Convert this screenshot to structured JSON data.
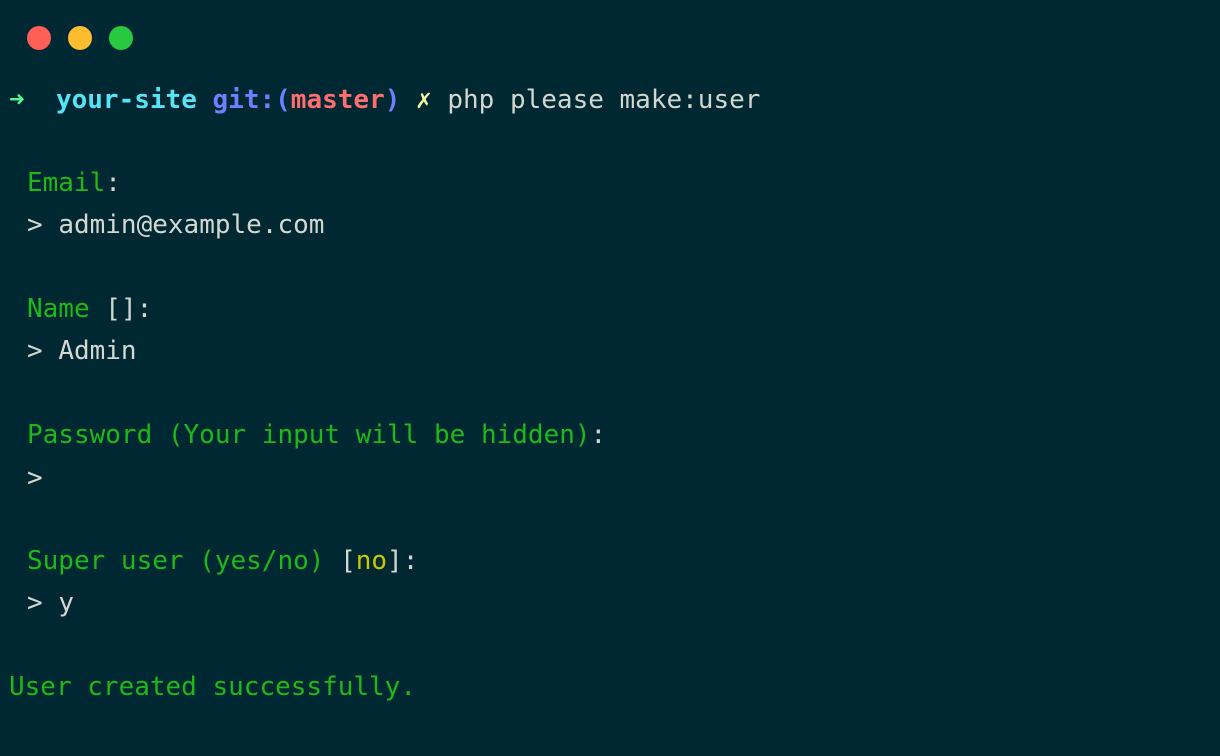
{
  "colors": {
    "background": "#002833",
    "close": "#ff5f57",
    "minimize": "#febc2e",
    "zoom": "#28c840",
    "arrow": "#5af78e",
    "dir": "#57e3f5",
    "git": "#6e7fff",
    "branch": "#ff6e6e",
    "dirty": "#f3f99d",
    "text": "#d3d7cf",
    "label": "#1fb818",
    "default_value": "#c8c800",
    "success": "#1fb818"
  },
  "window": {
    "close_icon": "close-icon",
    "minimize_icon": "minimize-icon",
    "zoom_icon": "zoom-icon"
  },
  "prompt": {
    "arrow": "➜",
    "directory": "your-site",
    "git_prefix": "git:(",
    "branch": "master",
    "git_suffix": ")",
    "dirty_mark": "✗",
    "command": "php please make:user"
  },
  "questions": {
    "email": {
      "label": "Email",
      "colon": ":",
      "answer_prefix": "> ",
      "answer": "admin@example.com"
    },
    "name": {
      "label": "Name",
      "default_open": " [",
      "default_value": "",
      "default_close": "]",
      "colon": ":",
      "answer_prefix": "> ",
      "answer": "Admin"
    },
    "password": {
      "label": "Password (Your input will be hidden)",
      "colon": ":",
      "answer_prefix": ">",
      "answer": ""
    },
    "super_user": {
      "label": "Super user (yes/no)",
      "default_open": " [",
      "default_value": "no",
      "default_close": "]",
      "colon": ":",
      "answer_prefix": "> ",
      "answer": "y"
    }
  },
  "result": {
    "message": "User created successfully."
  }
}
